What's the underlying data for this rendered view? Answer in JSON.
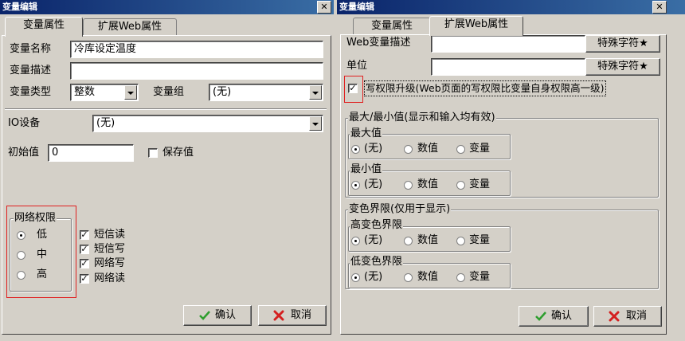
{
  "window_title": "变量编辑",
  "close_glyph": "✕",
  "tabs": {
    "props": "变量属性",
    "web": "扩展Web属性"
  },
  "left": {
    "var_name_label": "变量名称",
    "var_name_value": "冷库设定温度",
    "var_desc_label": "变量描述",
    "var_desc_value": "",
    "var_type_label": "变量类型",
    "var_type_value": "整数",
    "var_group_label": "变量组",
    "var_group_value": "(无)",
    "io_label": "IO设备",
    "io_value": "(无)",
    "init_label": "初始值",
    "init_value": "0",
    "save_label": "保存值",
    "net_perm_title": "网络权限",
    "perm_low": "低",
    "perm_mid": "中",
    "perm_high": "高",
    "sms_read": "短信读",
    "sms_write": "短信写",
    "net_write": "网络写",
    "net_read": "网络读",
    "ok": "确认",
    "cancel": "取消"
  },
  "right": {
    "web_desc_label": "Web变量描述",
    "unit_label": "单位",
    "special_char_btn": "特殊字符★",
    "write_upgrade": "写权限升级(Web页面的写权限比变量自身权限高一级)",
    "minmax_title": "最大/最小值(显示和输入均有效)",
    "max_title": "最大值",
    "min_title": "最小值",
    "color_limit_title": "变色界限(仅用于显示)",
    "high_title": "高变色界限",
    "low_title": "低变色界限",
    "opt_none": "(无)",
    "opt_value": "数值",
    "opt_var": "变量",
    "ok": "确认",
    "cancel": "取消"
  },
  "colors": {
    "title_start": "#0a246a",
    "title_end": "#3a6ea5",
    "highlight": "#e02020",
    "ok_icon": "#2e9e2e",
    "cancel_icon": "#d42020"
  }
}
